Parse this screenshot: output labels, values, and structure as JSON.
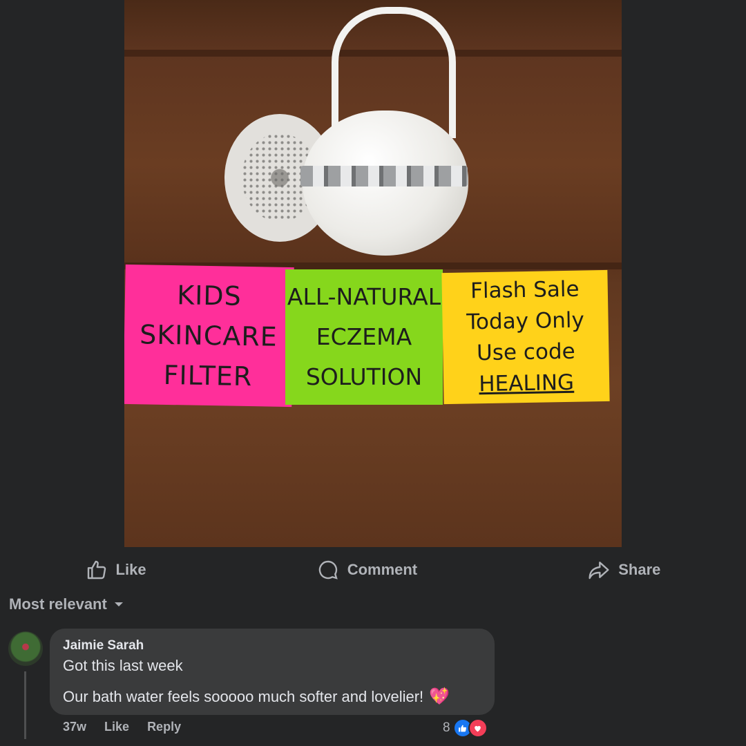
{
  "post_image": {
    "notes": {
      "pink": [
        "KIDS",
        "SKINCARE",
        "FILTER"
      ],
      "green": [
        "ALL-NATURAL",
        "ECZEMA",
        "SOLUTION"
      ],
      "yellow": [
        "Flash Sale",
        "Today Only",
        "Use code",
        "HEALING"
      ]
    }
  },
  "actions": {
    "like": "Like",
    "comment": "Comment",
    "share": "Share"
  },
  "sort": {
    "label": "Most relevant"
  },
  "comment": {
    "author": "Jaimie Sarah",
    "line1": "Got this last week",
    "line2": "Our bath water feels sooooo much softer and lovelier!",
    "emoji": "💖",
    "time": "37w",
    "like_label": "Like",
    "reply_label": "Reply",
    "reaction_count": "8"
  },
  "colors": {
    "background": "#242526",
    "bubble": "#3a3b3c",
    "muted_text": "#b0b3b8",
    "like_blue": "#1877f2",
    "love_red": "#f33e58"
  }
}
